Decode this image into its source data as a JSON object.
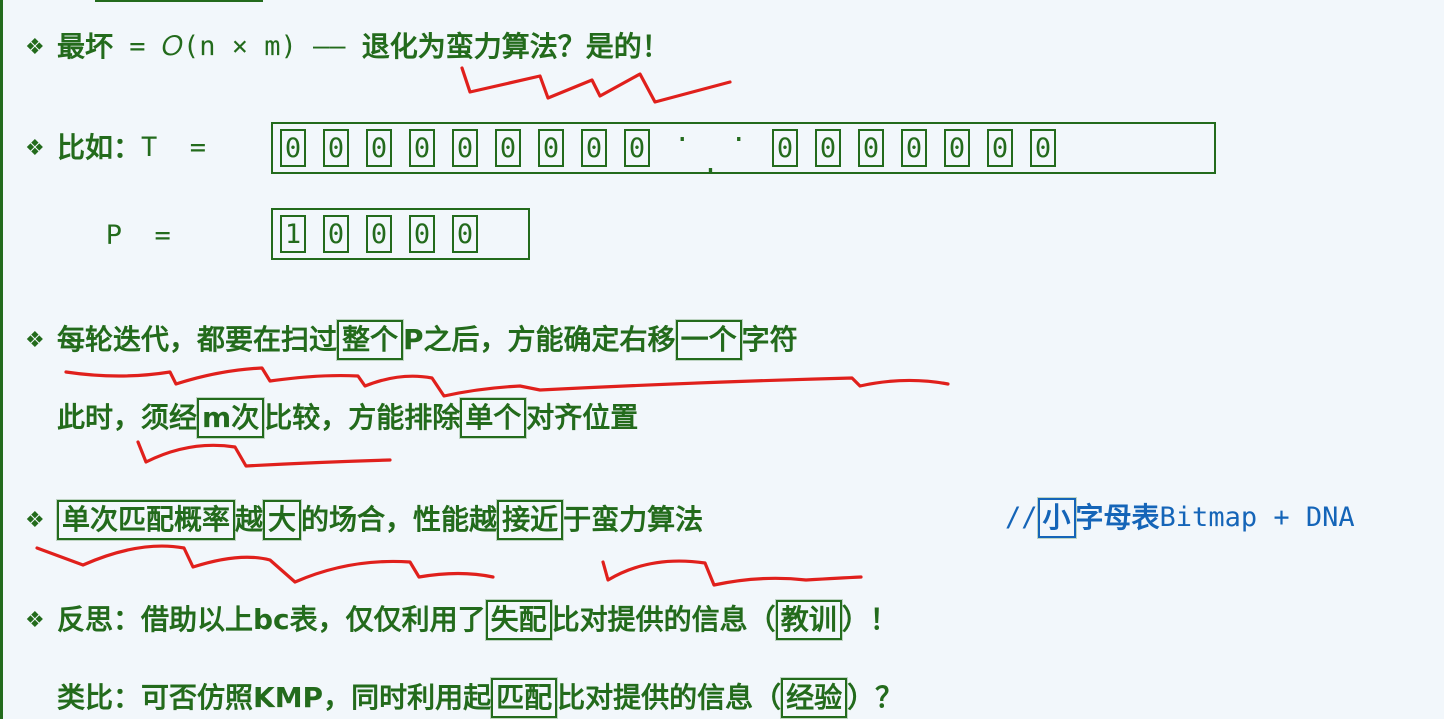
{
  "colors": {
    "text": "#236b1c",
    "accent_blue": "#1565b8",
    "annotation": "#e0201c",
    "background": "#f2f7fb"
  },
  "bullet_icon": "diamond-bullet",
  "lines": [
    {
      "bullet": "❖",
      "segs": [
        {
          "t": "最坏"
        },
        {
          "t": " = 𝑂(n × m) —— ",
          "mono": true
        },
        {
          "t": "退化为蛮力算法？是的！"
        }
      ]
    },
    {
      "bullet": "❖",
      "segs": [
        {
          "t": "比如："
        },
        {
          "t": "T  =",
          "mono": true
        }
      ]
    },
    {
      "bullet": "",
      "segs": [
        {
          "t": "   P  =",
          "mono": true
        }
      ]
    },
    {
      "bullet": "❖",
      "segs": [
        {
          "t": "每轮迭代，都要在扫过"
        },
        {
          "t": "整个",
          "box": true
        },
        {
          "t": "P之后，方能确定右移"
        },
        {
          "t": "一个",
          "box": true
        },
        {
          "t": "字符"
        }
      ]
    },
    {
      "bullet": "",
      "segs": [
        {
          "t": "此时，须经"
        },
        {
          "t": "m次",
          "box": true
        },
        {
          "t": "比较，方能排除"
        },
        {
          "t": "单个",
          "box": true
        },
        {
          "t": "对齐位置"
        }
      ]
    },
    {
      "bullet": "❖",
      "segs": [
        {
          "t": "单次匹配概率",
          "box": true
        },
        {
          "t": "越"
        },
        {
          "t": "大",
          "box": true
        },
        {
          "t": "的场合，性能越"
        },
        {
          "t": "接近",
          "box": true
        },
        {
          "t": "于蛮力算法"
        }
      ]
    },
    {
      "bullet": "❖",
      "segs": [
        {
          "t": "反思：借助以上bc表，仅仅利用了"
        },
        {
          "t": "失配",
          "box": true
        },
        {
          "t": "比对提供的信息（"
        },
        {
          "t": "教训",
          "box": true
        },
        {
          "t": "）！"
        }
      ]
    },
    {
      "bullet": "",
      "segs": [
        {
          "t": "类比：可否仿照KMP，同时利用起"
        },
        {
          "t": "匹配",
          "box": true
        },
        {
          "t": "比对提供的信息（"
        },
        {
          "t": "经验",
          "box": true
        },
        {
          "t": "）？"
        }
      ]
    }
  ],
  "comment": {
    "segs": [
      {
        "t": "//",
        "mono": true
      },
      {
        "t": "小",
        "box": true
      },
      {
        "t": "字母表"
      },
      {
        "t": "Bitmap + DNA",
        "mono": true
      }
    ]
  },
  "text_T": {
    "head": [
      "0",
      "0",
      "0",
      "0",
      "0",
      "0",
      "0",
      "0",
      "0"
    ],
    "ellipsis": ". . .",
    "tail": [
      "0",
      "0",
      "0",
      "0",
      "0",
      "0",
      "0"
    ]
  },
  "pattern_P": [
    "1",
    "0",
    "0",
    "0",
    "0"
  ]
}
